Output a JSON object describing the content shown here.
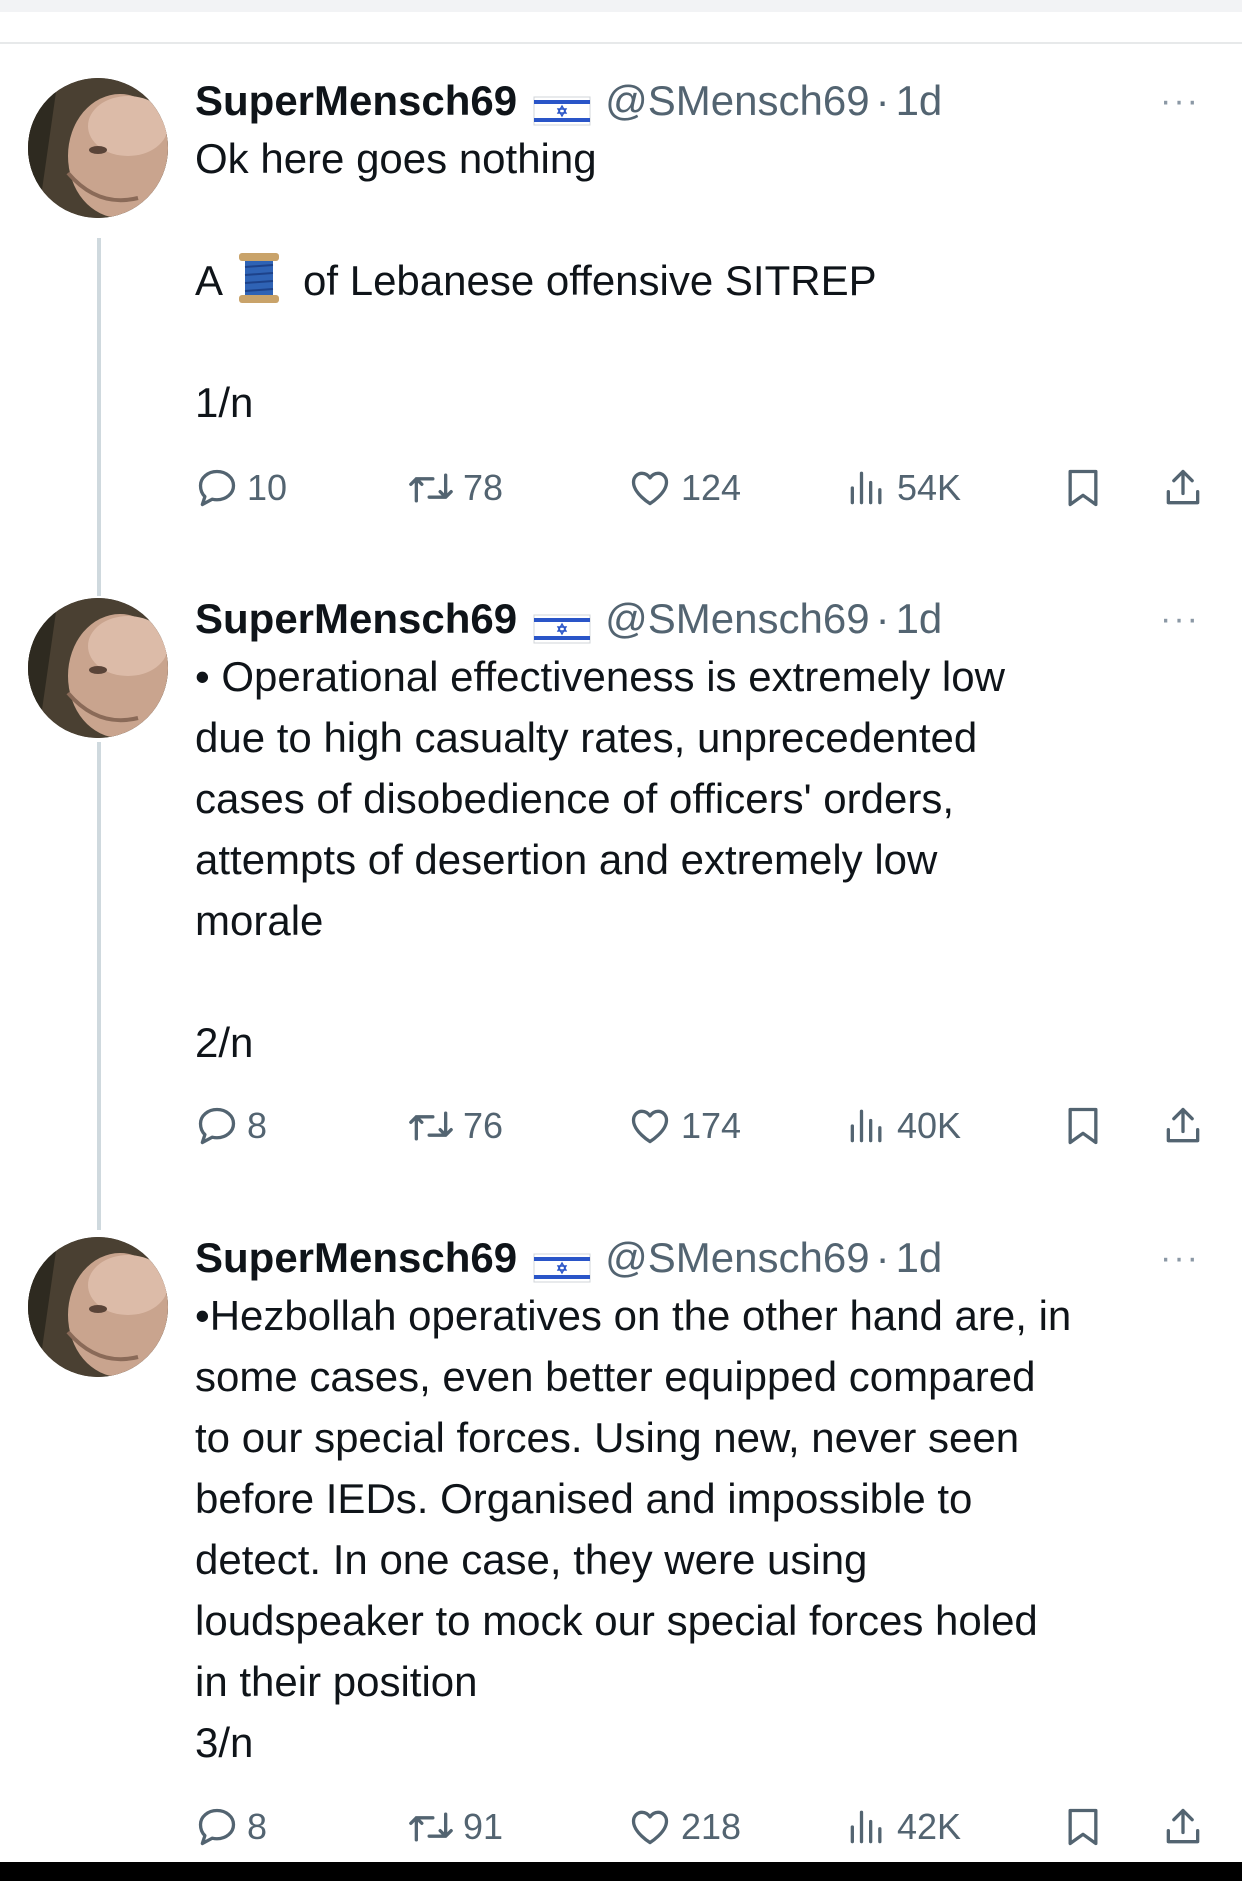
{
  "colors": {
    "text": "#0f1419",
    "secondary": "#536471",
    "thread_line": "#cfd9de",
    "flag_blue": "#2a55c8"
  },
  "icons": [
    "reply-icon",
    "retweet-icon",
    "like-icon",
    "views-icon",
    "bookmark-icon",
    "share-icon",
    "more-icon",
    "israel-flag-icon",
    "spool-emoji"
  ],
  "tweets": [
    {
      "name": "SuperMensch69",
      "handle": "@SMensch69",
      "dot": "·",
      "time": "1d",
      "more": "···",
      "text_before_emoji": "A",
      "text_after_emoji": "of Lebanese offensive SITREP",
      "line1": "Ok here goes nothing",
      "counter": "1/n",
      "replies": "10",
      "retweets": "78",
      "likes": "124",
      "views": "54K"
    },
    {
      "name": "SuperMensch69",
      "handle": "@SMensch69",
      "dot": "·",
      "time": "1d",
      "more": "···",
      "lines": [
        "• Operational effectiveness is extremely low",
        "due to high casualty rates, unprecedented",
        "cases of disobedience of officers' orders,",
        "attempts of desertion and extremely low",
        "morale"
      ],
      "counter": "2/n",
      "replies": "8",
      "retweets": "76",
      "likes": "174",
      "views": "40K"
    },
    {
      "name": "SuperMensch69",
      "handle": "@SMensch69",
      "dot": "·",
      "time": "1d",
      "more": "···",
      "lines": [
        "•Hezbollah operatives on the other hand are, in",
        "some cases, even better equipped compared",
        "to our special forces. Using new, never seen",
        "before IEDs. Organised and impossible to",
        "detect. In one case, they were using",
        "loudspeaker to mock our special forces holed",
        "in their position"
      ],
      "counter": "3/n",
      "replies": "8",
      "retweets": "91",
      "likes": "218",
      "views": "42K"
    }
  ]
}
